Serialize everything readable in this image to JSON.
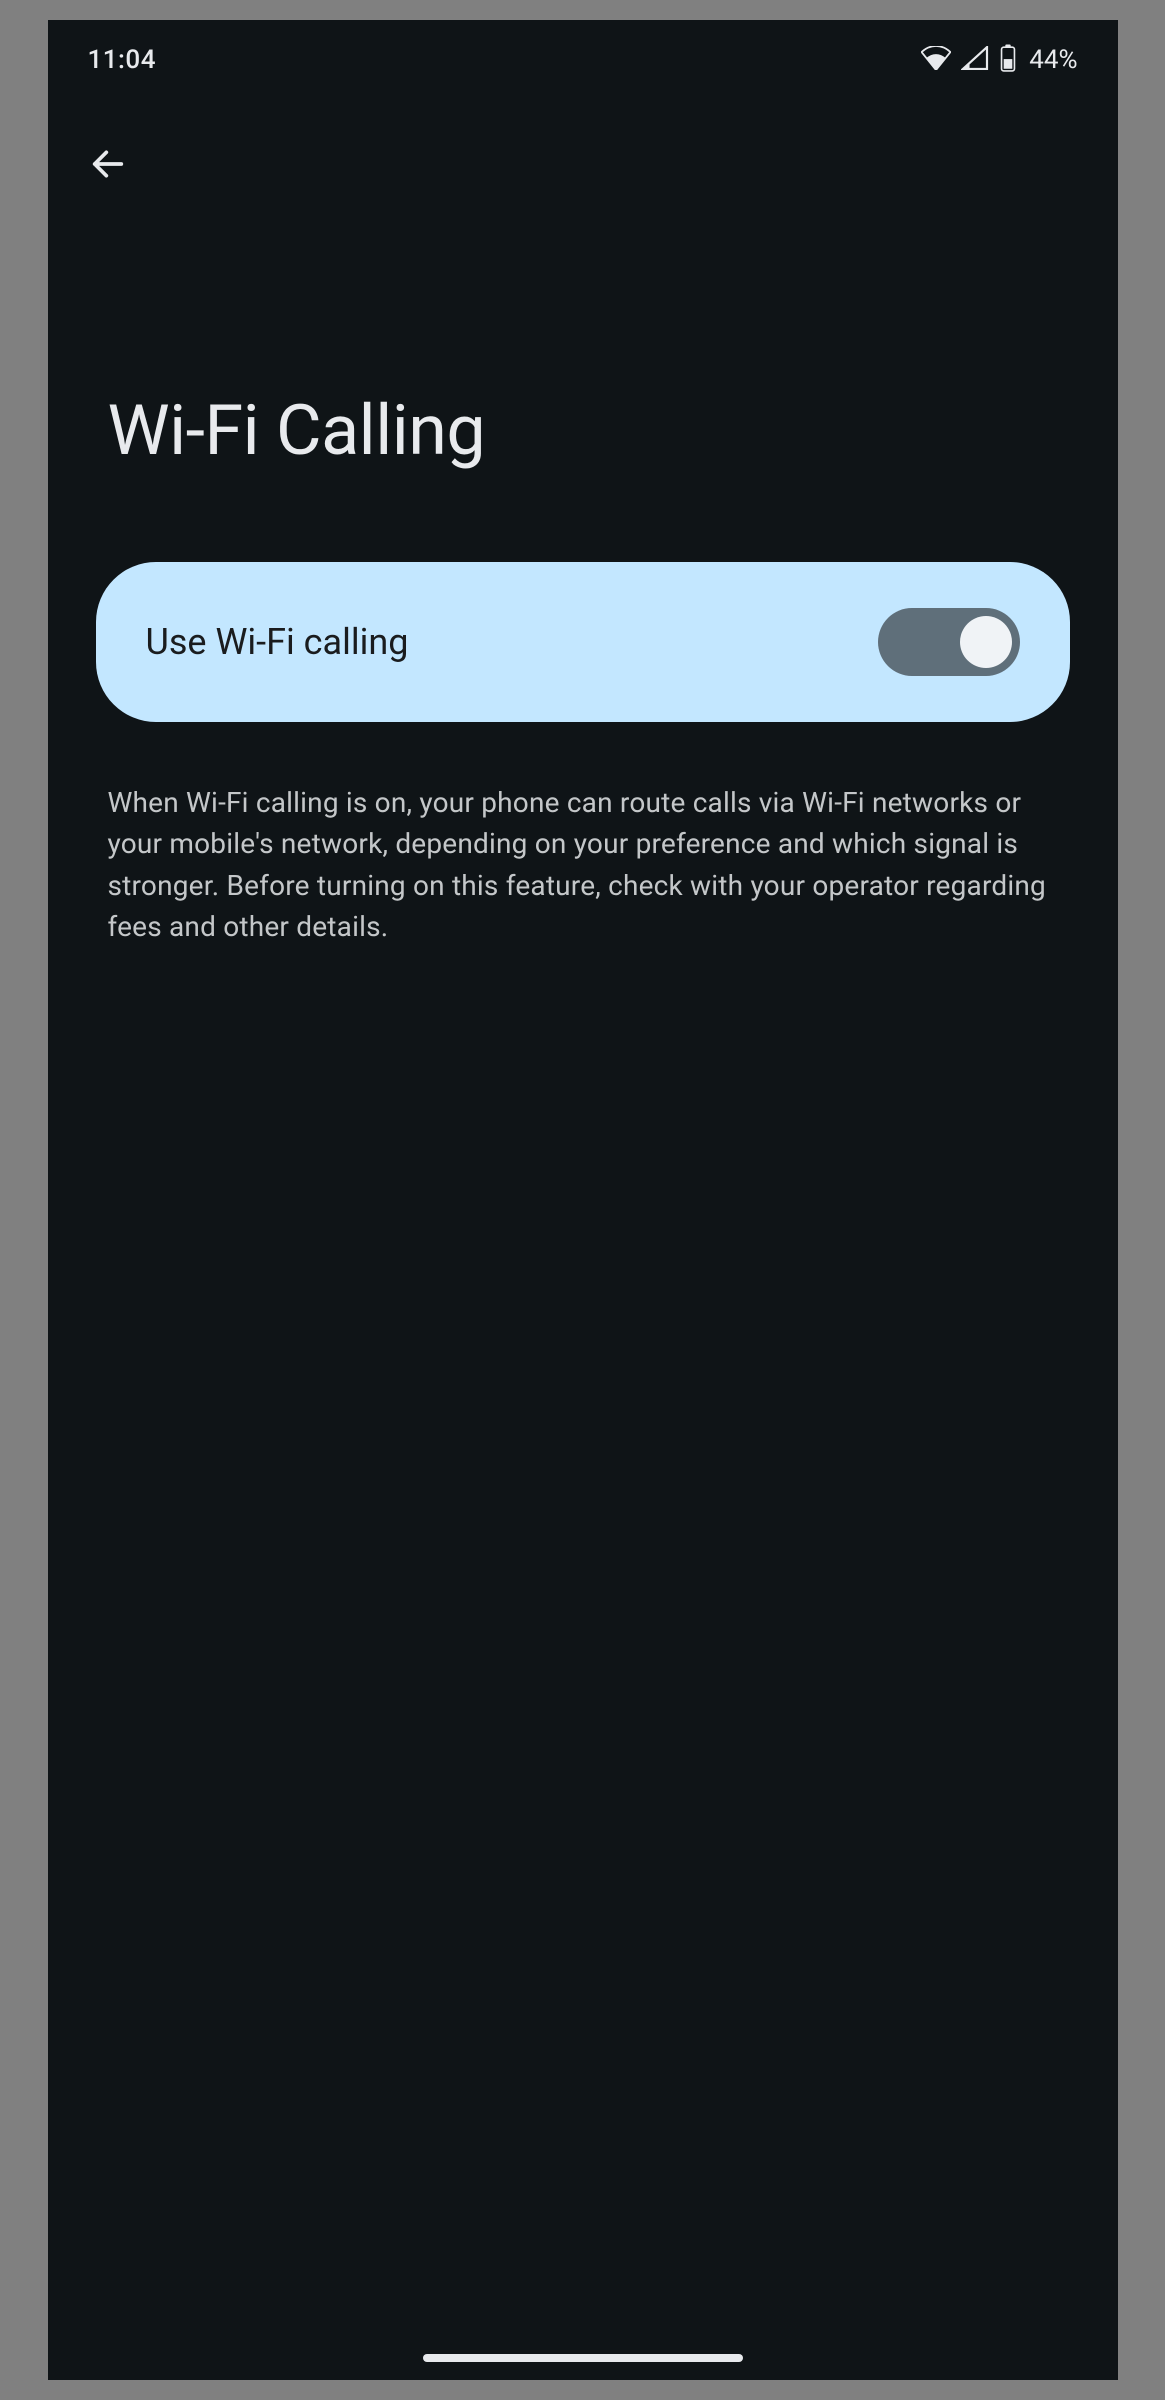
{
  "status_bar": {
    "time": "11:04",
    "battery_percent": "44%"
  },
  "page": {
    "title": "Wi-Fi Calling"
  },
  "toggle": {
    "label": "Use Wi-Fi calling",
    "state": "on"
  },
  "description": "When Wi-Fi calling is on, your phone can route calls via Wi-Fi networks or your mobile's network, depending on your preference and which signal is stronger. Before turning on this feature, check with your operator regarding fees and other details."
}
